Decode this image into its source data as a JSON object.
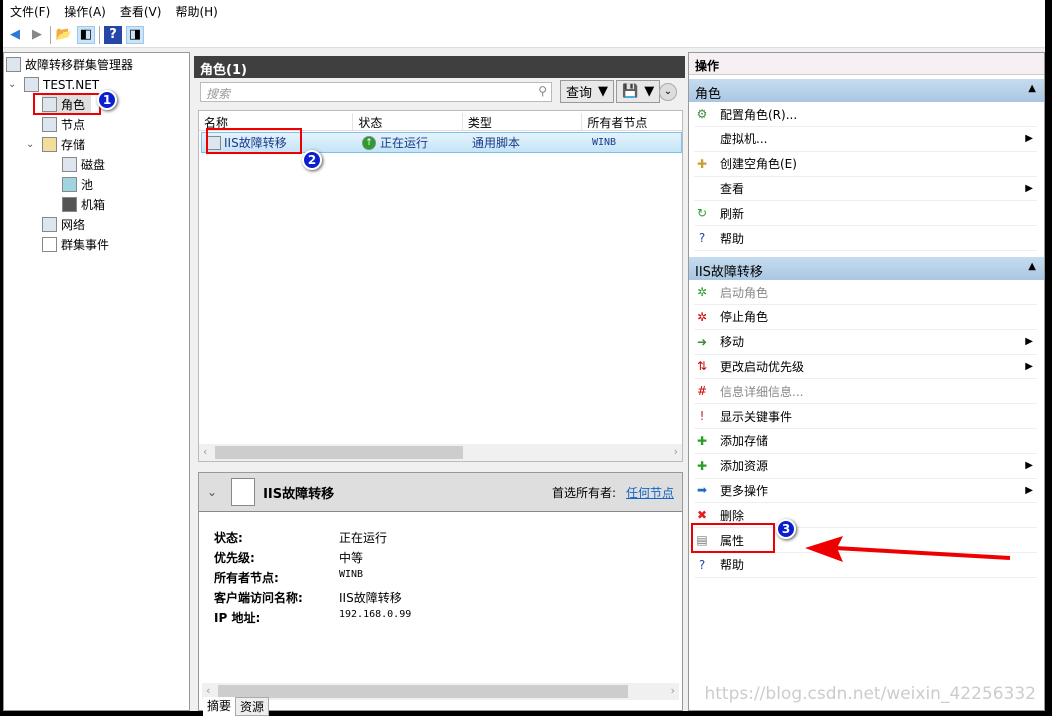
{
  "menu": [
    "文件(F)",
    "操作(A)",
    "查看(V)",
    "帮助(H)"
  ],
  "tree": {
    "root": "故障转移群集管理器",
    "cluster": "TEST.NET",
    "items": [
      "角色",
      "节点",
      "存储",
      "磁盘",
      "池",
      "机箱",
      "网络",
      "群集事件"
    ]
  },
  "badges": [
    "1",
    "2",
    "3"
  ],
  "roles": {
    "title": "角色(1)",
    "search_placeholder": "搜索",
    "query_label": "查询",
    "columns": [
      "名称",
      "状态",
      "类型",
      "所有者节点"
    ],
    "rows": [
      {
        "name": "IIS故障转移",
        "status": "正在运行",
        "type": "通用脚本",
        "owner": "WINB"
      }
    ]
  },
  "detail": {
    "title": "IIS故障转移",
    "preferred_owner_label": "首选所有者:",
    "preferred_owner_link": "任何节点",
    "fields": [
      {
        "k": "状态:",
        "v": "正在运行"
      },
      {
        "k": "优先级:",
        "v": "中等"
      },
      {
        "k": "所有者节点:",
        "v": "WINB"
      },
      {
        "k": "客户端访问名称:",
        "v": "IIS故障转移"
      },
      {
        "k": "IP 地址:",
        "v": "192.168.0.99"
      }
    ],
    "tabs": [
      "摘要",
      "资源"
    ]
  },
  "actions": {
    "title": "操作",
    "section1": "角色",
    "items1": [
      "配置角色(R)...",
      "虚拟机...",
      "创建空角色(E)",
      "查看",
      "刷新",
      "帮助"
    ],
    "section2": "IIS故障转移",
    "items2": [
      "启动角色",
      "停止角色",
      "移动",
      "更改启动优先级",
      "信息详细信息...",
      "显示关键事件",
      "添加存储",
      "添加资源",
      "更多操作",
      "删除",
      "属性",
      "帮助"
    ]
  },
  "watermark": "https://blog.csdn.net/weixin_42256332",
  "colors": {
    "highlight": "#e00000",
    "badge": "#0b1fd0",
    "section": "#b8d1ea"
  }
}
